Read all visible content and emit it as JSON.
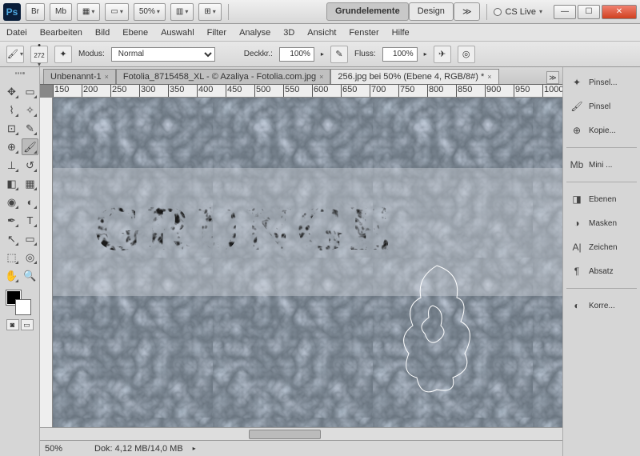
{
  "titlebar": {
    "br": "Br",
    "mb": "Mb",
    "zoom": "50%",
    "cslive": "CS Live"
  },
  "workspace": {
    "active": "Grundelemente",
    "other": "Design",
    "more": "≫"
  },
  "menu": {
    "datei": "Datei",
    "bearbeiten": "Bearbeiten",
    "bild": "Bild",
    "ebene": "Ebene",
    "auswahl": "Auswahl",
    "filter": "Filter",
    "analyse": "Analyse",
    "dreid": "3D",
    "ansicht": "Ansicht",
    "fenster": "Fenster",
    "hilfe": "Hilfe"
  },
  "options": {
    "brush_size": "272",
    "modus_label": "Modus:",
    "modus_value": "Normal",
    "deckkr_label": "Deckkr.:",
    "deckkr_value": "100%",
    "fluss_label": "Fluss:",
    "fluss_value": "100%"
  },
  "tabs": {
    "t1": "Unbenannt-1",
    "t2": "Fotolia_8715458_XL - © Azaliya - Fotolia.com.jpg",
    "t3": "256.jpg bei 50% (Ebene 4, RGB/8#) *"
  },
  "ruler_ticks": [
    "150",
    "200",
    "250",
    "300",
    "350",
    "400",
    "450",
    "500",
    "550",
    "600",
    "650",
    "700",
    "750",
    "800",
    "850",
    "900",
    "950",
    "1000"
  ],
  "canvas": {
    "text": "GRUNGE"
  },
  "status": {
    "zoom": "50%",
    "dok": "Dok: 4,12 MB/14,0 MB"
  },
  "panels": {
    "pinsel1": "Pinsel...",
    "pinsel2": "Pinsel",
    "kopie": "Kopie...",
    "mini": "Mini ...",
    "ebenen": "Ebenen",
    "masken": "Masken",
    "zeichen": "Zeichen",
    "absatz": "Absatz",
    "korre": "Korre..."
  }
}
